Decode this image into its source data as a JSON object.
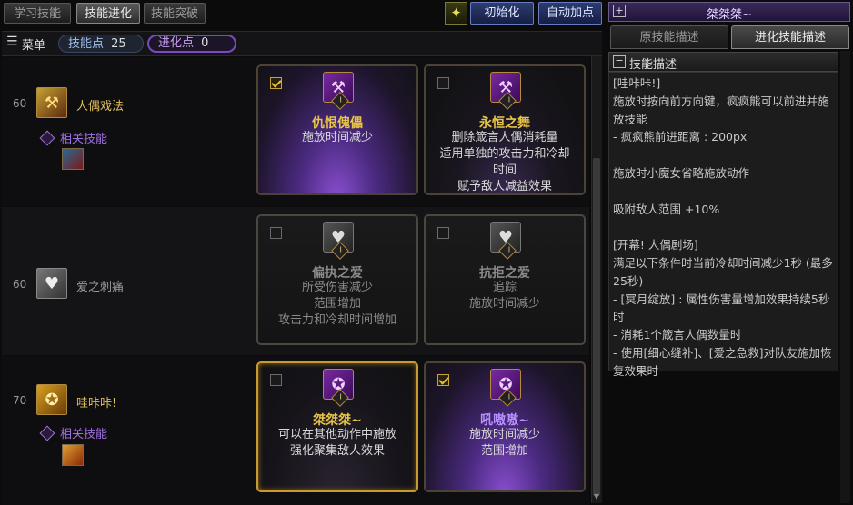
{
  "top_tabs": [
    "学习技能",
    "技能进化",
    "技能突破"
  ],
  "buttons": {
    "init": "初始化",
    "auto": "自动加点"
  },
  "menu": {
    "label": "菜单",
    "skill_points_label": "技能点",
    "skill_points_value": "25",
    "evo_points_label": "进化点",
    "evo_points_value": "0"
  },
  "rows": [
    {
      "level": "60",
      "name": "人偶戏法",
      "related": "相关技能",
      "cards": [
        {
          "title": "仇恨傀儡",
          "desc": [
            "施放时间减少"
          ],
          "checked": true,
          "roman": "I"
        },
        {
          "title": "永恒之舞",
          "desc": [
            "删除箴言人偶消耗量",
            "适用单独的攻击力和冷却",
            "时间",
            "赋予敌人减益效果"
          ],
          "checked": false,
          "roman": "II"
        }
      ]
    },
    {
      "level": "60",
      "name": "爱之刺痛",
      "cards": [
        {
          "title": "偏执之爱",
          "desc": [
            "所受伤害减少",
            "范围增加",
            "攻击力和冷却时间增加"
          ],
          "checked": false,
          "roman": "I"
        },
        {
          "title": "抗拒之爱",
          "desc": [
            "追踪",
            "施放时间减少"
          ],
          "checked": false,
          "roman": "II"
        }
      ]
    },
    {
      "level": "70",
      "name": "哇咔咔!",
      "related": "相关技能",
      "cards": [
        {
          "title": "桀桀桀~",
          "desc": [
            "可以在其他动作中施放",
            "强化聚集敌人效果"
          ],
          "checked": false,
          "roman": "I"
        },
        {
          "title": "吼嗷嗷~",
          "desc": [
            "施放时间减少",
            "范围增加"
          ],
          "checked": true,
          "roman": "II"
        }
      ]
    }
  ],
  "right_panel": {
    "header_title": "桀桀桀~",
    "tabs": [
      "原技能描述",
      "进化技能描述"
    ],
    "section_title": "技能描述",
    "lines": [
      "[哇咔咔!]",
      "施放时按向前方向键，疯疯熊可以前进并施放技能",
      "- 疯疯熊前进距离 : 200px",
      "",
      "施放时小魔女省略施放动作",
      "",
      "吸附敌人范围 +10%",
      "",
      "[开幕! 人偶剧场]",
      "满足以下条件时当前冷却时间减少1秒 (最多25秒)",
      "- [冥月绽放] : 属性伤害量增加效果持续5秒时",
      "- 消耗1个箴言人偶数量时",
      "- 使用[细心缝补]、[爱之急救]对队友施加恢复效果时"
    ]
  },
  "colors": {
    "gold": "#e8c448",
    "purple": "#a070e0",
    "blue_btn": "#2d3c70"
  }
}
